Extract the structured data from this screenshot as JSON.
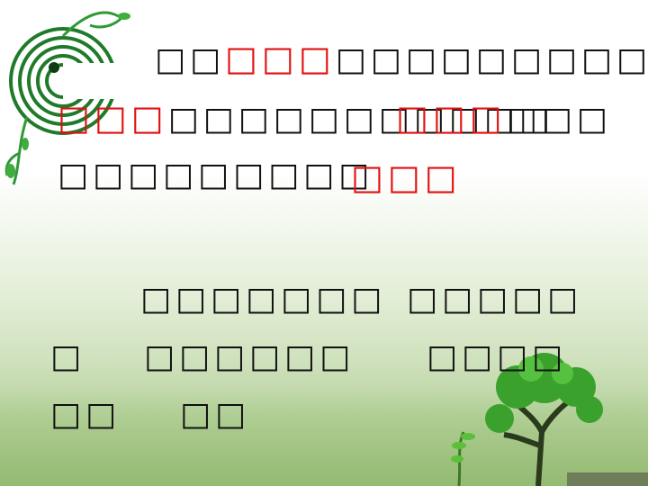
{
  "paragraph1": {
    "line1": {
      "lead": "□□",
      "red": "□□□",
      "tail": "□□□□□□□□□□"
    },
    "line2": {
      "red1": "□□□",
      "mid": "□□□□□□□□□□□",
      "red2": "□□□",
      "tail": "□□□"
    },
    "line3": {
      "lead": "□□□□□□□□□",
      "red": "□□□"
    }
  },
  "paragraph2": {
    "line1": {
      "partA": "□□□□□□□",
      "partB": "□□□□□"
    },
    "line2": {
      "partA": "□",
      "partB": "□□□□□□",
      "partC": "□□□□"
    },
    "line3": {
      "partA": "□□",
      "partB": "□□"
    }
  },
  "colors": {
    "highlight": "#e01010",
    "text": "#111111",
    "accent_green": "#2f8a2a"
  }
}
